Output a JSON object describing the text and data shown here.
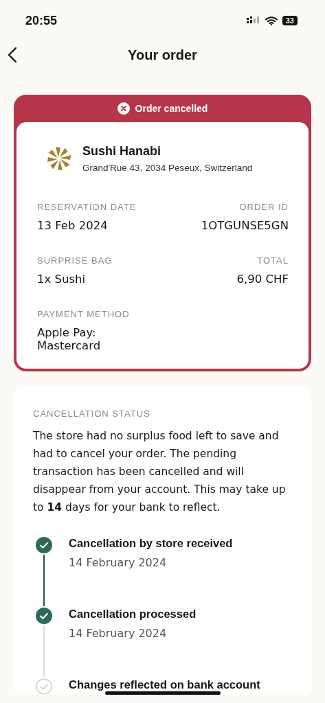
{
  "status_bar": {
    "time": "20:55",
    "battery": "33"
  },
  "header": {
    "title": "Your order"
  },
  "order_card": {
    "banner": "Order cancelled",
    "store": {
      "name": "Sushi Hanabi",
      "address": "Grand'Rue 43, 2034 Peseux, Switzerland"
    },
    "fields": [
      {
        "label": "RESERVATION DATE",
        "value": "13 Feb 2024"
      },
      {
        "label": "ORDER ID",
        "value": "1OTGUNSE5GN"
      },
      {
        "label": "SURPRISE BAG",
        "value": "1x Sushi"
      },
      {
        "label": "TOTAL",
        "value": "6,90 CHF"
      },
      {
        "label": "PAYMENT METHOD",
        "value": "Apple Pay: Mastercard"
      }
    ]
  },
  "cancellation": {
    "heading": "CANCELLATION STATUS",
    "message": "The store had no surplus food left to save and had to cancel your order. The pending transaction has been cancelled and will disappear from your account. This may take up to **14** days for your bank to reflect.",
    "steps": [
      {
        "title": "Cancellation by store received",
        "date": "14 February 2024",
        "done": true
      },
      {
        "title": "Cancellation processed",
        "date": "14 February 2024",
        "done": true
      },
      {
        "title": "Changes reflected on bank account",
        "done": false
      }
    ]
  }
}
